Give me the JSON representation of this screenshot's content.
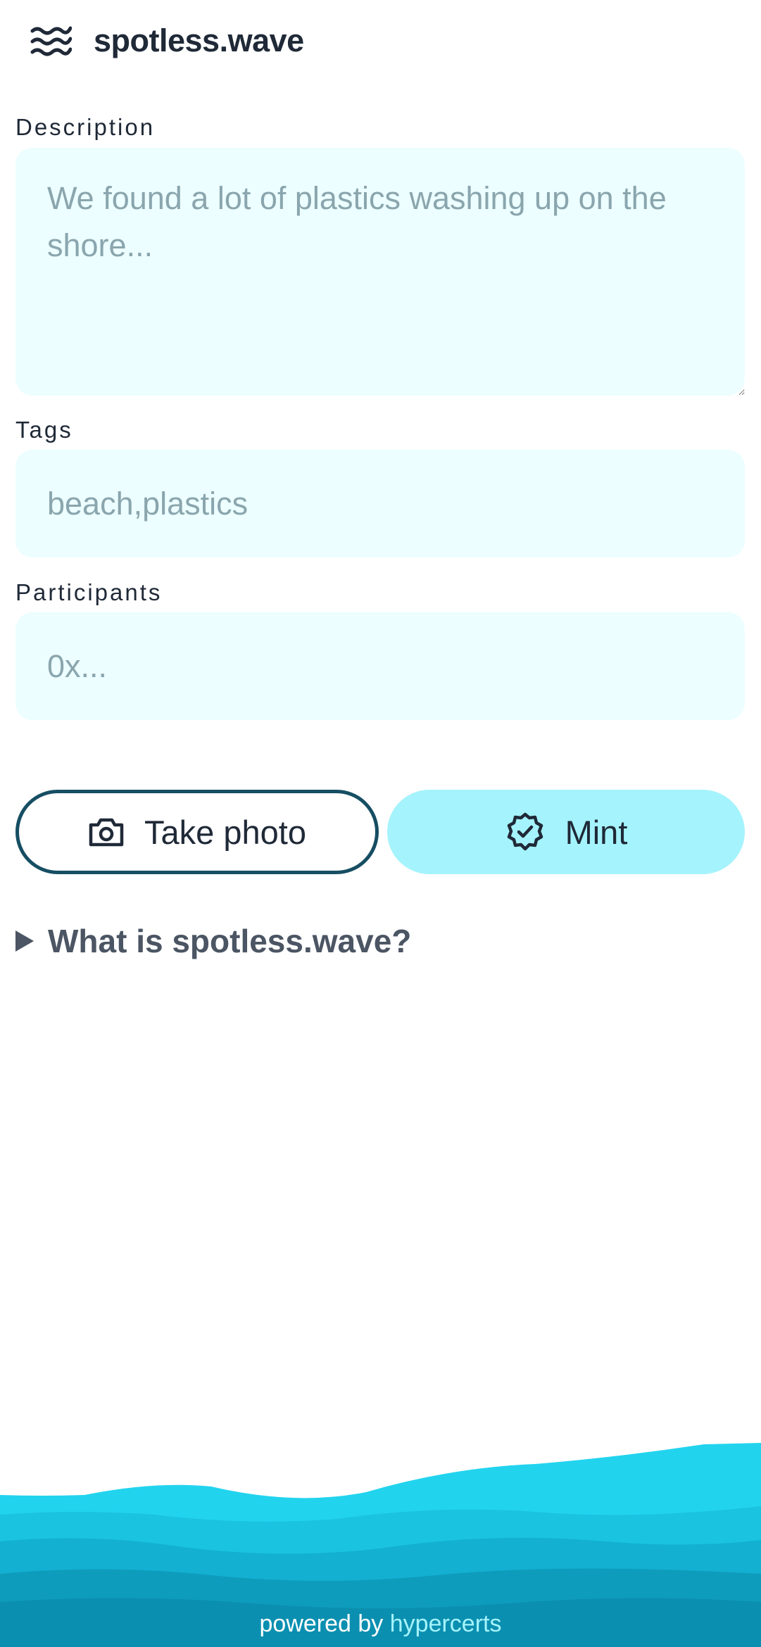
{
  "header": {
    "logo_icon": "waves-icon",
    "title": "spotless.wave"
  },
  "form": {
    "description": {
      "label": "Description",
      "value": "",
      "placeholder": "We found a lot of plastics washing up on the shore..."
    },
    "tags": {
      "label": "Tags",
      "value": "",
      "placeholder": "beach,plastics"
    },
    "participants": {
      "label": "Participants",
      "value": "",
      "placeholder": "0x..."
    }
  },
  "actions": {
    "take_photo": {
      "label": "Take photo",
      "icon": "camera-icon"
    },
    "mint": {
      "label": "Mint",
      "icon": "badge-check-icon"
    }
  },
  "details": {
    "summary": "What is spotless.wave?",
    "icon": "disclosure-triangle-icon"
  },
  "footer": {
    "prefix": "powered by",
    "link": "hypercerts"
  },
  "colors": {
    "field_bg": "#ecfeff",
    "mint_bg": "#a5f3fc",
    "photo_border": "#164e63",
    "wave_1": "#22d3ee",
    "wave_2": "#1ac3e0",
    "wave_3": "#13b0d1",
    "wave_4": "#0e9cbd",
    "wave_5": "#0b8fb0"
  }
}
